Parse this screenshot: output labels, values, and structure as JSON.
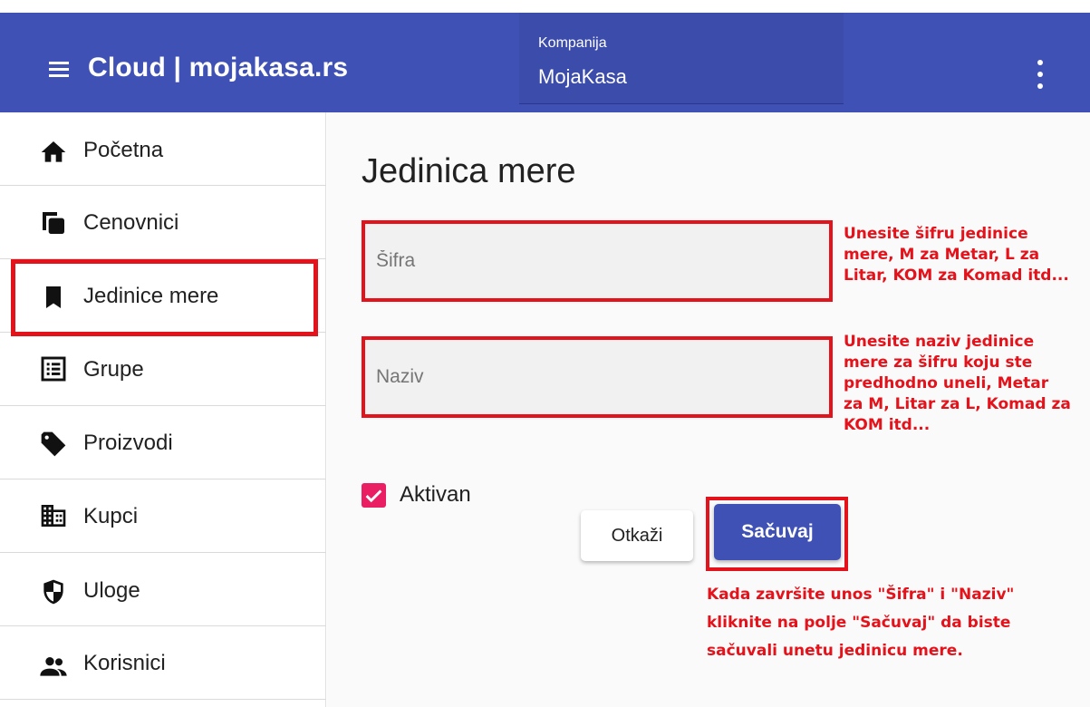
{
  "app": {
    "title": "Cloud | mojakasa.rs"
  },
  "company": {
    "label": "Kompanija",
    "value": "MojaKasa"
  },
  "sidebar": {
    "items": [
      {
        "label": "Početna",
        "icon": "home-icon"
      },
      {
        "label": "Cenovnici",
        "icon": "copy-icon"
      },
      {
        "label": "Jedinice mere",
        "icon": "bookmark-icon",
        "active": true
      },
      {
        "label": "Grupe",
        "icon": "list-box-icon"
      },
      {
        "label": "Proizvodi",
        "icon": "tag-icon"
      },
      {
        "label": "Kupci",
        "icon": "building-icon"
      },
      {
        "label": "Uloge",
        "icon": "shield-icon"
      },
      {
        "label": "Korisnici",
        "icon": "people-icon"
      }
    ]
  },
  "form": {
    "title": "Jedinica mere",
    "sifra_placeholder": "Šifra",
    "sifra_value": "",
    "naziv_placeholder": "Naziv",
    "naziv_value": "",
    "active_label": "Aktivan",
    "active_checked": true,
    "cancel_label": "Otkaži",
    "save_label": "Sačuvaj"
  },
  "annotations": {
    "sifra": [
      "Unesite šifru jedinice",
      "mere, M za Metar, L za",
      "Litar, KOM za Komad itd..."
    ],
    "naziv": [
      "Unesite naziv jedinice",
      "mere za šifru koju ste",
      "predhodno uneli, Metar",
      "za M, Litar za L, Komad za",
      "KOM itd..."
    ],
    "save": [
      "Kada završite unos \"Šifra\" i \"Naziv\"",
      "kliknite na polje \"Sačuvaj\" da biste",
      "sačuvali unetu jedinicu mere."
    ]
  },
  "colors": {
    "primary": "#3f51b5",
    "accent": "#e91e63",
    "annotation": "#e4121a"
  }
}
